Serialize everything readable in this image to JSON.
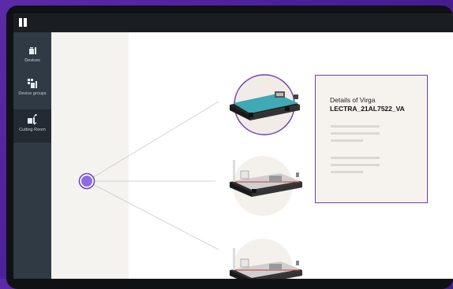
{
  "nav": {
    "items": [
      {
        "label": "Devices",
        "icon": "device-icon",
        "active": false
      },
      {
        "label": "Device groups",
        "icon": "device-groups-icon",
        "active": false
      },
      {
        "label": "Cutting Room",
        "icon": "cutting-room-icon",
        "active": true
      }
    ]
  },
  "details": {
    "title": "Details of Virga",
    "device_name": "LECTRA_21AL7522_VA"
  },
  "colors": {
    "accent": "#6b3fb5",
    "node": "#8d6ae6",
    "sidebar": "#2f3a45",
    "sidebar_active": "#222a32",
    "topbar": "#1a1d21"
  }
}
